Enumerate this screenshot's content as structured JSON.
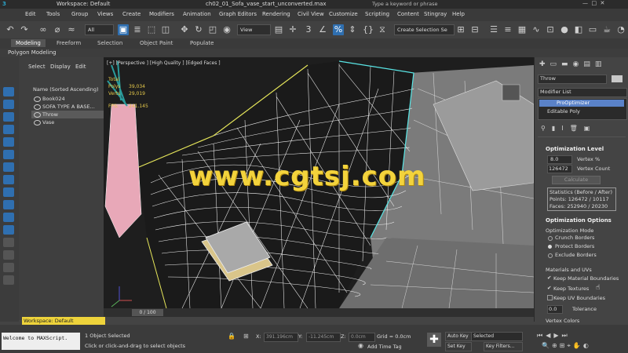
{
  "titlebar": {
    "workspace": "Workspace: Default",
    "file": "ch02_01_Sofa_vase_start_unconverted.max",
    "search_placeholder": "Type a keyword or phrase"
  },
  "menu": [
    "Edit",
    "Tools",
    "Group",
    "Views",
    "Create",
    "Modifiers",
    "Animation",
    "Graph Editors",
    "Rendering",
    "Civil View",
    "Customize",
    "Scripting",
    "Content",
    "Stingray",
    "Help"
  ],
  "toolbar": {
    "filter": "All",
    "view": "View",
    "selection_set": "Create Selection Se"
  },
  "ribbon": {
    "tabs": [
      "Modeling",
      "Freeform",
      "Selection",
      "Object Paint",
      "Populate"
    ],
    "sub": "Polygon Modeling"
  },
  "scene_explorer": {
    "tabs": [
      "Select",
      "Display",
      "Edit"
    ],
    "sort": "Name (Sorted Ascending)",
    "items": [
      "Book024",
      "SOFA TYPE A BASE...",
      "Throw",
      "Vase"
    ]
  },
  "viewport": {
    "label": "[+] [Perspective ] [High Quality ] [Edged Faces ]",
    "stats_title": "Total",
    "stats": [
      {
        "k": "Polys",
        "v": "39,034"
      },
      {
        "k": "Verts",
        "v": "29,019"
      }
    ],
    "fps_label": "FPS:",
    "fps": "241.145",
    "watermark": "www.cgtsj.com"
  },
  "command_panel": {
    "object_name": "Throw",
    "modifier_list": "Modifier List",
    "stack": [
      "ProOptimizer",
      "Editable Poly"
    ],
    "opt_level_title": "Optimization Level",
    "vertex_pct_value": "8.0",
    "vertex_pct_label": "Vertex %",
    "vertex_count_value": "126472",
    "vertex_count_label": "Vertex Count",
    "calculate": "Calculate",
    "stats_header": "Statistics (Before / After)",
    "stats_points": "Points: 126472 / 10117",
    "stats_faces": "Faces: 252940 / 20230",
    "opt_options_title": "Optimization Options",
    "opt_mode": "Optimization Mode",
    "modes": [
      "Crunch Borders",
      "Protect Borders",
      "Exclude Borders"
    ],
    "mat_uv": "Materials and UVs",
    "keep": [
      "Keep Material Boundaries",
      "Keep Textures",
      "Keep UV Boundaries"
    ],
    "tolerance_value": "0.0",
    "tolerance_label": "Tolerance",
    "vertex_colors": "Vertex Colors"
  },
  "timeline": {
    "frame": "0 / 100"
  },
  "workspace_bar": "Workspace: Default",
  "status": {
    "script": "Welcome to MAXScript.",
    "selected": "1 Object Selected",
    "hint": "Click or click-and-drag to select objects",
    "x_label": "X:",
    "x": "391.196cm",
    "y_label": "Y:",
    "y": "-11.245cm",
    "z_label": "Z:",
    "z": "0.0cm",
    "grid": "Grid = 0.0cm",
    "add_time_tag": "Add Time Tag",
    "auto_key": "Auto Key",
    "set_key": "Set Key",
    "key_selected": "Selected",
    "key_filters": "Key Filters..."
  }
}
